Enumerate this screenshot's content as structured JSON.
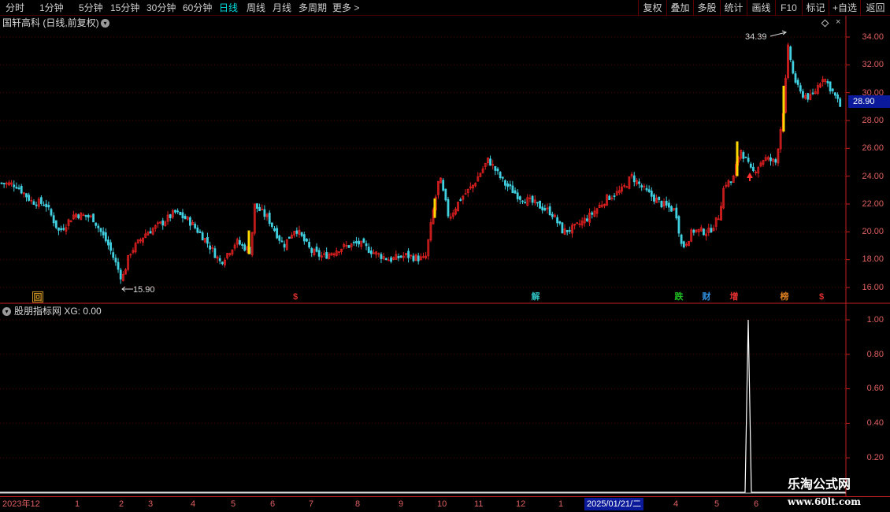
{
  "toolbar": {
    "periods": [
      "分时",
      "1分钟",
      "5分钟",
      "15分钟",
      "30分钟",
      "60分钟",
      "日线",
      "周线",
      "月线",
      "多周期",
      "更多 >"
    ],
    "active_period": "日线",
    "tools": [
      "复权",
      "叠加",
      "多股",
      "统计",
      "画线",
      "F10",
      "标记",
      "+自选",
      "返回"
    ]
  },
  "main_panel": {
    "title": "国轩高科 (日线,前复权)",
    "current_price": "28.90",
    "high_label": "34.39",
    "low_label": "15.90",
    "badges": [
      {
        "text": "回",
        "color": "#c89020"
      },
      {
        "text": "$",
        "color": "#e03030"
      },
      {
        "text": "解",
        "color": "#30c0c0"
      },
      {
        "text": "跌",
        "color": "#20c020"
      },
      {
        "text": "财",
        "color": "#3090e0"
      },
      {
        "text": "增",
        "color": "#e03030"
      },
      {
        "text": "榜",
        "color": "#e08020"
      },
      {
        "text": "$",
        "color": "#e03030"
      }
    ]
  },
  "price_axis": [
    "34.00",
    "32.00",
    "30.00",
    "28.00",
    "26.00",
    "24.00",
    "22.00",
    "20.00",
    "18.00",
    "16.00"
  ],
  "sub_panel": {
    "title": "股朋指标网 XG: 0.00",
    "axis": [
      "1.00",
      "0.80",
      "0.60",
      "0.40",
      "0.20"
    ]
  },
  "date_axis": {
    "labels": [
      "2023年12",
      "1",
      "2",
      "3",
      "4",
      "5",
      "6",
      "7",
      "8",
      "9",
      "10",
      "11",
      "12",
      "1",
      "4",
      "5",
      "6"
    ],
    "current": "2025/01/21/二"
  },
  "watermark": {
    "title": "乐淘公式网",
    "url": "www.60lt.com"
  },
  "colors": {
    "up": "#e02020",
    "down": "#40d0e0",
    "signal": "#ffd800",
    "grid": "#5a0000"
  }
}
